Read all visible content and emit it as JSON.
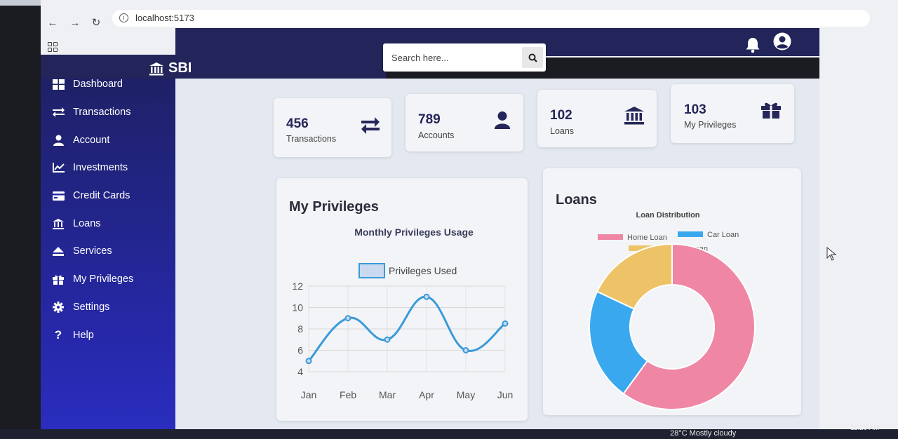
{
  "browser": {
    "url": "localhost:5173"
  },
  "app": {
    "brand": "SBI",
    "search_placeholder": "Search here...",
    "colors": {
      "navy": "#22245a",
      "sidebar": "#2628a8",
      "accent_line": "#3a9ad9"
    }
  },
  "sidebar": {
    "items": [
      {
        "label": "Dashboard",
        "icon": "dashboard-icon"
      },
      {
        "label": "Transactions",
        "icon": "exchange-icon"
      },
      {
        "label": "Account",
        "icon": "user-icon"
      },
      {
        "label": "Investments",
        "icon": "chart-line-icon"
      },
      {
        "label": "Credit Cards",
        "icon": "credit-card-icon"
      },
      {
        "label": "Loans",
        "icon": "bank-icon"
      },
      {
        "label": "Services",
        "icon": "eject-icon"
      },
      {
        "label": "My Privileges",
        "icon": "gift-icon"
      },
      {
        "label": "Settings",
        "icon": "gear-icon"
      },
      {
        "label": "Help",
        "icon": "question-icon"
      }
    ]
  },
  "stats": [
    {
      "value": "456",
      "label": "Transactions",
      "icon": "exchange-icon"
    },
    {
      "value": "789",
      "label": "Accounts",
      "icon": "user-icon"
    },
    {
      "value": "102",
      "label": "Loans",
      "icon": "bank-icon"
    },
    {
      "value": "103",
      "label": "My Privileges",
      "icon": "gift-icon"
    }
  ],
  "privileges_panel": {
    "title": "My Privileges"
  },
  "loans_panel": {
    "title": "Loans"
  },
  "chart_data": [
    {
      "type": "line",
      "title": "Monthly Privileges Usage",
      "categories": [
        "Jan",
        "Feb",
        "Mar",
        "Apr",
        "May",
        "Jun"
      ],
      "series": [
        {
          "name": "Privileges Used",
          "values": [
            5,
            9,
            7,
            11,
            6,
            8.5
          ]
        }
      ],
      "ylim": [
        4,
        12
      ],
      "yticks": [
        4,
        6,
        8,
        10,
        12
      ],
      "legend": "top",
      "grid": true,
      "color": "#3a9ad9"
    },
    {
      "type": "pie",
      "title": "Loan Distribution",
      "categories": [
        "Home Loan",
        "Car Loan",
        "Personal Loan"
      ],
      "values": [
        60,
        22,
        18
      ],
      "colors": [
        "#ef86a4",
        "#3aa8ee",
        "#eec266"
      ],
      "legend": "top"
    }
  ],
  "taskbar": {
    "weather": "28°C  Mostly cloudy",
    "time": "11:20 AM"
  }
}
